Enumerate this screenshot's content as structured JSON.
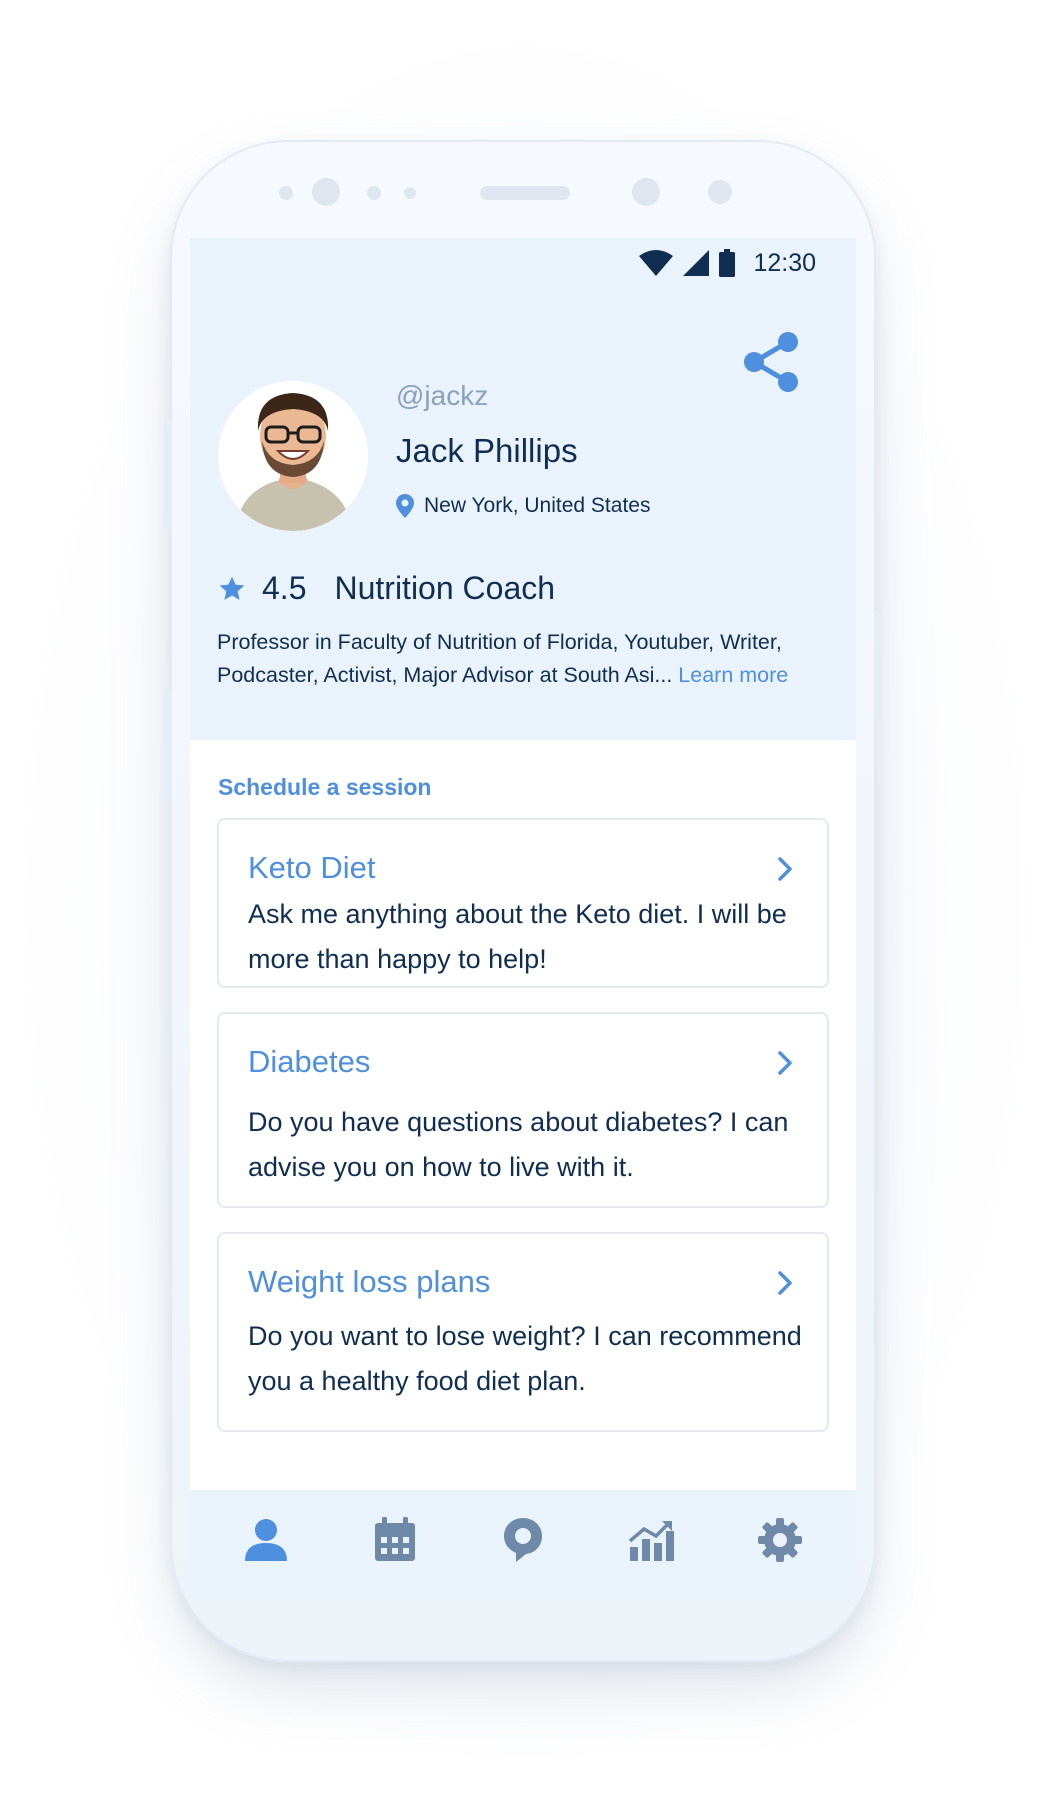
{
  "status_bar": {
    "time": "12:30",
    "icons": [
      "wifi-icon",
      "signal-icon",
      "battery-icon"
    ]
  },
  "profile": {
    "handle": "@jackz",
    "name": "Jack Phillips",
    "location": "New York, United States",
    "rating": "4.5",
    "title": "Nutrition Coach",
    "bio": "Professor in Faculty of Nutrition of Florida, Youtuber, Writer, Podcaster, Activist, Major Advisor at South Asi...",
    "learn_more": "Learn more"
  },
  "schedule": {
    "title": "Schedule a session",
    "cards": [
      {
        "title": "Keto Diet",
        "description": "Ask me anything about the Keto diet. I will be more than happy to help!"
      },
      {
        "title": "Diabetes",
        "description": "Do you have questions about diabetes? I can advise you on how to live with it."
      },
      {
        "title": "Weight loss plans",
        "description": "Do you want to lose weight? I can recommend you a healthy food diet plan."
      }
    ]
  },
  "bottom_nav": {
    "items": [
      "profile-icon",
      "calendar-icon",
      "chat-icon",
      "analytics-icon",
      "settings-icon"
    ],
    "active": "profile-icon"
  },
  "colors": {
    "accent": "#4e8fde",
    "text_dark": "#0f2e52",
    "muted": "#8aa1ba",
    "screen_bg": "#eaf2fc",
    "nav_inactive": "#6f8aa8"
  }
}
